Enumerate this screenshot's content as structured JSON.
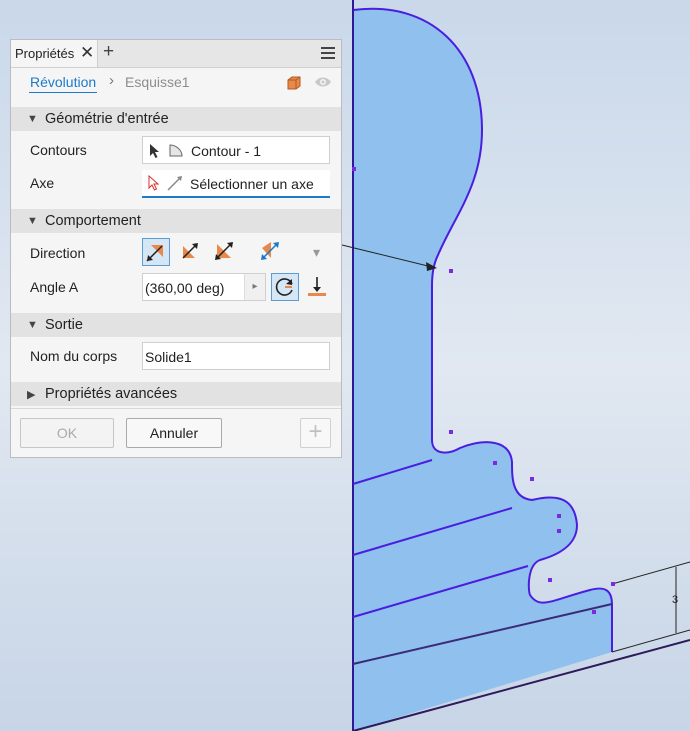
{
  "panel": {
    "tab_label": "Propriétés",
    "close_glyph": "✕",
    "add_glyph": "+",
    "breadcrumb": {
      "active": "Révolution",
      "separator": "›",
      "item": "Esquisse1"
    },
    "sections": {
      "input": {
        "toggle": "▼",
        "title": "Géométrie d'entrée"
      },
      "behavior": {
        "toggle": "▼",
        "title": "Comportement"
      },
      "output": {
        "toggle": "▼",
        "title": "Sortie"
      },
      "advanced": {
        "toggle": "▶",
        "title": "Propriétés avancées"
      }
    },
    "contours": {
      "label": "Contours",
      "value": "Contour - 1"
    },
    "axe": {
      "label": "Axe",
      "value": "Sélectionner un axe"
    },
    "direction": {
      "label": "Direction",
      "dropdown_glyph": "▾"
    },
    "angle": {
      "label": "Angle A",
      "value": "(360,00 deg)",
      "arrow_glyph": "▸"
    },
    "body_name": {
      "label": "Nom du corps",
      "value": "Solide1"
    },
    "buttons": {
      "ok": "OK",
      "cancel": "Annuler",
      "add_glyph": "+"
    }
  },
  "canvas": {
    "dimension_text": "3",
    "colors": {
      "fill": "#8fc0ee",
      "edge": "#4a1ee0",
      "point": "#7a2be0"
    }
  },
  "colors": {
    "accent": "#1c7ac9",
    "orange": "#e8884a"
  }
}
